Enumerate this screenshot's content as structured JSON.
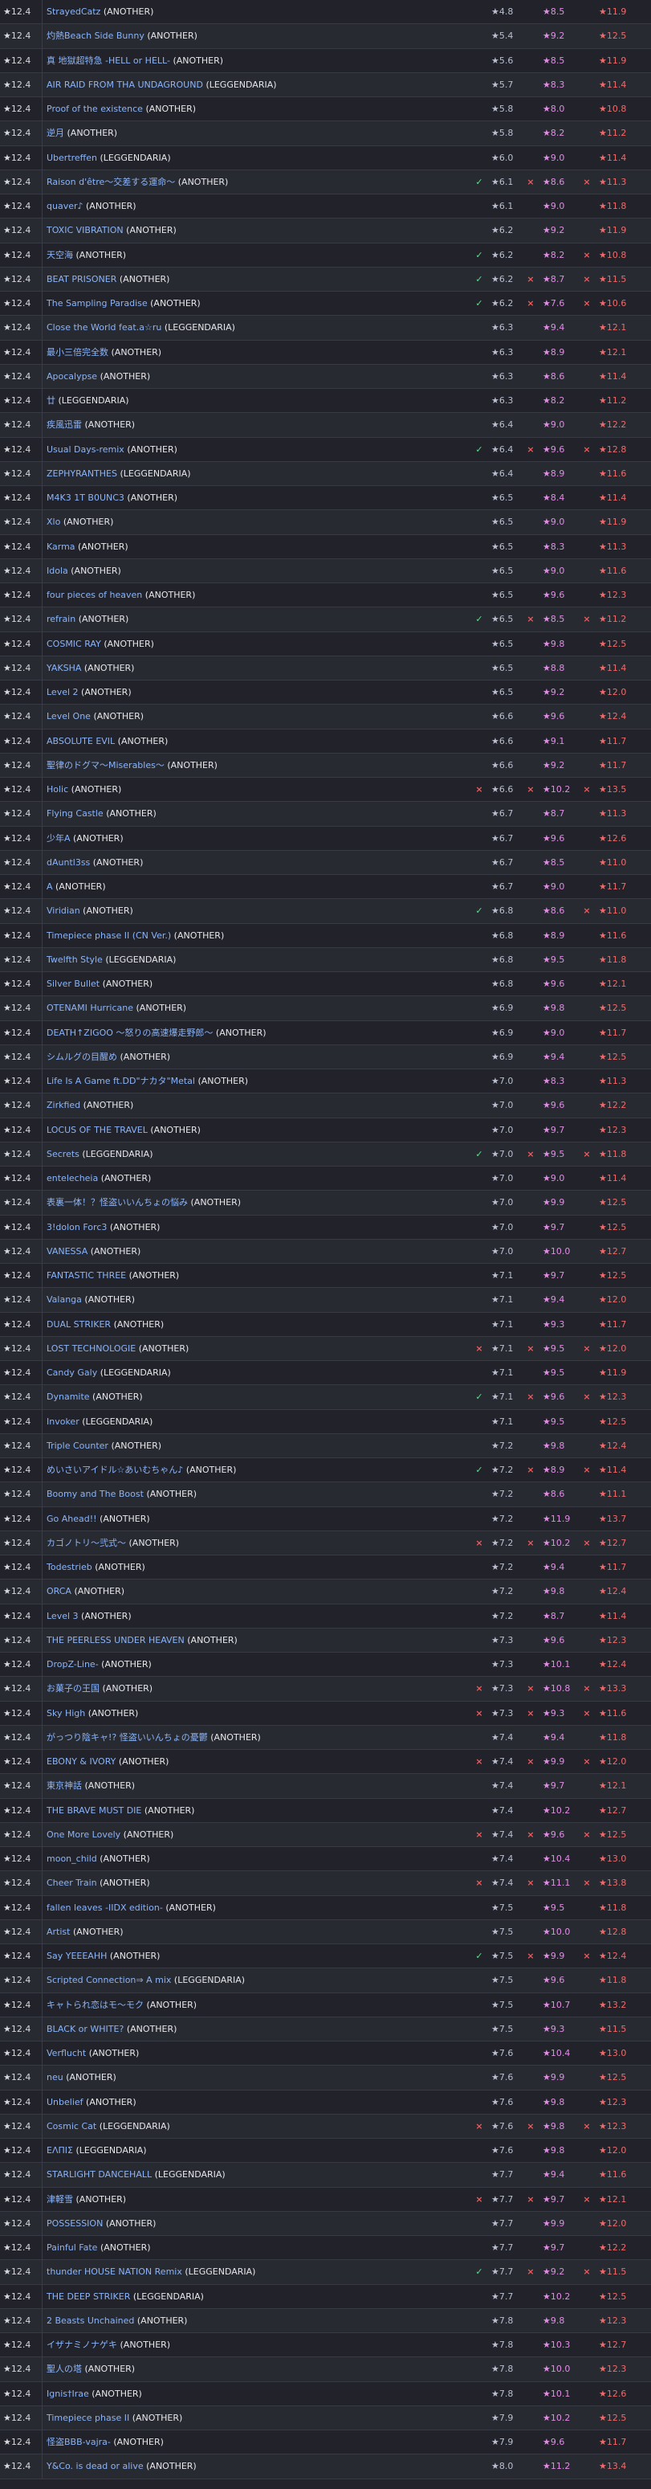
{
  "level_label": "★12.4",
  "rows": [
    {
      "title": "StrayedCatz",
      "diff": "(ANOTHER)",
      "s1": "★4.8",
      "s2": "★8.5",
      "s3": "★11.9"
    },
    {
      "title": "灼熱Beach Side Bunny",
      "diff": "(ANOTHER)",
      "s1": "★5.4",
      "s2": "★9.2",
      "s3": "★12.5"
    },
    {
      "title": "真 地獄超特急 -HELL or HELL-",
      "diff": "(ANOTHER)",
      "s1": "★5.6",
      "s2": "★8.5",
      "s3": "★11.9"
    },
    {
      "title": "AIR RAID FROM THA UNDAGROUND",
      "diff": "(LEGGENDARIA)",
      "s1": "★5.7",
      "s2": "★8.3",
      "s3": "★11.4"
    },
    {
      "title": "Proof of the existence",
      "diff": "(ANOTHER)",
      "s1": "★5.8",
      "s2": "★8.0",
      "s3": "★10.8"
    },
    {
      "title": "逆月",
      "diff": "(ANOTHER)",
      "s1": "★5.8",
      "s2": "★8.2",
      "s3": "★11.2"
    },
    {
      "title": "Ubertreffen",
      "diff": "(LEGGENDARIA)",
      "s1": "★6.0",
      "s2": "★9.0",
      "s3": "★11.4"
    },
    {
      "title": "Raison d'être～交差する運命～",
      "diff": "(ANOTHER)",
      "m1": "✓",
      "m2": "×",
      "m3": "×",
      "s1": "★6.1",
      "s2": "★8.6",
      "s3": "★11.3"
    },
    {
      "title": "quaver♪",
      "diff": "(ANOTHER)",
      "s1": "★6.1",
      "s2": "★9.0",
      "s3": "★11.8"
    },
    {
      "title": "TOXIC VIBRATION",
      "diff": "(ANOTHER)",
      "s1": "★6.2",
      "s2": "★9.2",
      "s3": "★11.9"
    },
    {
      "title": "天空海",
      "diff": "(ANOTHER)",
      "m1": "✓",
      "m3": "×",
      "s1": "★6.2",
      "s2": "★8.2",
      "s3": "★10.8"
    },
    {
      "title": "BEAT PRISONER",
      "diff": "(ANOTHER)",
      "m1": "✓",
      "m2": "×",
      "m3": "×",
      "s1": "★6.2",
      "s2": "★8.7",
      "s3": "★11.5"
    },
    {
      "title": "The Sampling Paradise",
      "diff": "(ANOTHER)",
      "m1": "✓",
      "m2": "×",
      "m3": "×",
      "s1": "★6.2",
      "s2": "★7.6",
      "s3": "★10.6"
    },
    {
      "title": "Close the World feat.a☆ru",
      "diff": "(LEGGENDARIA)",
      "s1": "★6.3",
      "s2": "★9.4",
      "s3": "★12.1"
    },
    {
      "title": "最小三倍完全数",
      "diff": "(ANOTHER)",
      "s1": "★6.3",
      "s2": "★8.9",
      "s3": "★12.1"
    },
    {
      "title": "Apocalypse",
      "diff": "(ANOTHER)",
      "s1": "★6.3",
      "s2": "★8.6",
      "s3": "★11.4"
    },
    {
      "title": "廿",
      "diff": "(LEGGENDARIA)",
      "s1": "★6.3",
      "s2": "★8.2",
      "s3": "★11.2"
    },
    {
      "title": "疾風迅雷",
      "diff": "(ANOTHER)",
      "s1": "★6.4",
      "s2": "★9.0",
      "s3": "★12.2"
    },
    {
      "title": "Usual Days-remix",
      "diff": "(ANOTHER)",
      "m1": "✓",
      "m2": "×",
      "m3": "×",
      "s1": "★6.4",
      "s2": "★9.6",
      "s3": "★12.8"
    },
    {
      "title": "ZEPHYRANTHES",
      "diff": "(LEGGENDARIA)",
      "s1": "★6.4",
      "s2": "★8.9",
      "s3": "★11.6"
    },
    {
      "title": "M4K3 1T B0UNC3",
      "diff": "(ANOTHER)",
      "s1": "★6.5",
      "s2": "★8.4",
      "s3": "★11.4"
    },
    {
      "title": "Xlo",
      "diff": "(ANOTHER)",
      "s1": "★6.5",
      "s2": "★9.0",
      "s3": "★11.9"
    },
    {
      "title": "Karma",
      "diff": "(ANOTHER)",
      "s1": "★6.5",
      "s2": "★8.3",
      "s3": "★11.3"
    },
    {
      "title": "Idola",
      "diff": "(ANOTHER)",
      "s1": "★6.5",
      "s2": "★9.0",
      "s3": "★11.6"
    },
    {
      "title": "four pieces of heaven",
      "diff": "(ANOTHER)",
      "s1": "★6.5",
      "s2": "★9.6",
      "s3": "★12.3"
    },
    {
      "title": "refrain",
      "diff": "(ANOTHER)",
      "m1": "✓",
      "m2": "×",
      "m3": "×",
      "s1": "★6.5",
      "s2": "★8.5",
      "s3": "★11.2"
    },
    {
      "title": "COSMIC RAY",
      "diff": "(ANOTHER)",
      "s1": "★6.5",
      "s2": "★9.8",
      "s3": "★12.5"
    },
    {
      "title": "YAKSHA",
      "diff": "(ANOTHER)",
      "s1": "★6.5",
      "s2": "★8.8",
      "s3": "★11.4"
    },
    {
      "title": "Level 2",
      "diff": "(ANOTHER)",
      "s1": "★6.5",
      "s2": "★9.2",
      "s3": "★12.0"
    },
    {
      "title": "Level One",
      "diff": "(ANOTHER)",
      "s1": "★6.6",
      "s2": "★9.6",
      "s3": "★12.4"
    },
    {
      "title": "ABSOLUTE EVIL",
      "diff": "(ANOTHER)",
      "s1": "★6.6",
      "s2": "★9.1",
      "s3": "★11.7"
    },
    {
      "title": "聖律のドグマ～Miserables～",
      "diff": "(ANOTHER)",
      "s1": "★6.6",
      "s2": "★9.2",
      "s3": "★11.7"
    },
    {
      "title": "Holic",
      "diff": "(ANOTHER)",
      "m1": "×",
      "m2": "×",
      "m3": "×",
      "s1": "★6.6",
      "s2": "★10.2",
      "s3": "★13.5"
    },
    {
      "title": "Flying Castle",
      "diff": "(ANOTHER)",
      "s1": "★6.7",
      "s2": "★8.7",
      "s3": "★11.3"
    },
    {
      "title": "少年A",
      "diff": "(ANOTHER)",
      "s1": "★6.7",
      "s2": "★9.6",
      "s3": "★12.6"
    },
    {
      "title": "dAuntl3ss",
      "diff": "(ANOTHER)",
      "s1": "★6.7",
      "s2": "★8.5",
      "s3": "★11.0"
    },
    {
      "title": "A",
      "diff": "(ANOTHER)",
      "s1": "★6.7",
      "s2": "★9.0",
      "s3": "★11.7"
    },
    {
      "title": "Viridian",
      "diff": "(ANOTHER)",
      "m1": "✓",
      "m3": "×",
      "s1": "★6.8",
      "s2": "★8.6",
      "s3": "★11.0"
    },
    {
      "title": "Timepiece phase II (CN Ver.)",
      "diff": "(ANOTHER)",
      "s1": "★6.8",
      "s2": "★8.9",
      "s3": "★11.6"
    },
    {
      "title": "Twelfth Style",
      "diff": "(LEGGENDARIA)",
      "s1": "★6.8",
      "s2": "★9.5",
      "s3": "★11.8"
    },
    {
      "title": "Silver Bullet",
      "diff": "(ANOTHER)",
      "s1": "★6.8",
      "s2": "★9.6",
      "s3": "★12.1"
    },
    {
      "title": "OTENAMI Hurricane",
      "diff": "(ANOTHER)",
      "s1": "★6.9",
      "s2": "★9.8",
      "s3": "★12.5"
    },
    {
      "title": "DEATH↑ZIGOO ～怒りの高速爆走野郎～",
      "diff": "(ANOTHER)",
      "s1": "★6.9",
      "s2": "★9.0",
      "s3": "★11.7"
    },
    {
      "title": "シムルグの目醒め",
      "diff": "(ANOTHER)",
      "s1": "★6.9",
      "s2": "★9.4",
      "s3": "★12.5"
    },
    {
      "title": "Life Is A Game ft.DD\"ナカタ\"Metal",
      "diff": "(ANOTHER)",
      "s1": "★7.0",
      "s2": "★8.3",
      "s3": "★11.3"
    },
    {
      "title": "Zirkfied",
      "diff": "(ANOTHER)",
      "s1": "★7.0",
      "s2": "★9.6",
      "s3": "★12.2"
    },
    {
      "title": "LOCUS OF THE TRAVEL",
      "diff": "(ANOTHER)",
      "s1": "★7.0",
      "s2": "★9.7",
      "s3": "★12.3"
    },
    {
      "title": "Secrets",
      "diff": "(LEGGENDARIA)",
      "m1": "✓",
      "m2": "×",
      "m3": "×",
      "s1": "★7.0",
      "s2": "★9.5",
      "s3": "★11.8"
    },
    {
      "title": "entelecheia",
      "diff": "(ANOTHER)",
      "s1": "★7.0",
      "s2": "★9.0",
      "s3": "★11.4"
    },
    {
      "title": "表裏一体！？怪盗いいんちょの悩み",
      "diff": "(ANOTHER)",
      "s1": "★7.0",
      "s2": "★9.9",
      "s3": "★12.5"
    },
    {
      "title": "3!dolon Forc3",
      "diff": "(ANOTHER)",
      "s1": "★7.0",
      "s2": "★9.7",
      "s3": "★12.5"
    },
    {
      "title": "VANESSA",
      "diff": "(ANOTHER)",
      "s1": "★7.0",
      "s2": "★10.0",
      "s3": "★12.7"
    },
    {
      "title": "FANTASTIC THREE",
      "diff": "(ANOTHER)",
      "s1": "★7.1",
      "s2": "★9.7",
      "s3": "★12.5"
    },
    {
      "title": "Valanga",
      "diff": "(ANOTHER)",
      "s1": "★7.1",
      "s2": "★9.4",
      "s3": "★12.0"
    },
    {
      "title": "DUAL STRIKER",
      "diff": "(ANOTHER)",
      "s1": "★7.1",
      "s2": "★9.3",
      "s3": "★11.7"
    },
    {
      "title": "LOST TECHNOLOGIE",
      "diff": "(ANOTHER)",
      "m1": "×",
      "m2": "×",
      "m3": "×",
      "s1": "★7.1",
      "s2": "★9.5",
      "s3": "★12.0"
    },
    {
      "title": "Candy Galy",
      "diff": "(LEGGENDARIA)",
      "s1": "★7.1",
      "s2": "★9.5",
      "s3": "★11.9"
    },
    {
      "title": "Dynamite",
      "diff": "(ANOTHER)",
      "m1": "✓",
      "m2": "×",
      "m3": "×",
      "s1": "★7.1",
      "s2": "★9.6",
      "s3": "★12.3"
    },
    {
      "title": "Invoker",
      "diff": "(LEGGENDARIA)",
      "s1": "★7.1",
      "s2": "★9.5",
      "s3": "★12.5"
    },
    {
      "title": "Triple Counter",
      "diff": "(ANOTHER)",
      "s1": "★7.2",
      "s2": "★9.8",
      "s3": "★12.4"
    },
    {
      "title": "めいさいアイドル☆あいむちゃん♪",
      "diff": "(ANOTHER)",
      "m1": "✓",
      "m2": "×",
      "m3": "×",
      "s1": "★7.2",
      "s2": "★8.9",
      "s3": "★11.4"
    },
    {
      "title": "Boomy and The Boost",
      "diff": "(ANOTHER)",
      "s1": "★7.2",
      "s2": "★8.6",
      "s3": "★11.1"
    },
    {
      "title": "Go Ahead!!",
      "diff": "(ANOTHER)",
      "s1": "★7.2",
      "s2": "★11.9",
      "s3": "★13.7"
    },
    {
      "title": "カゴノトリ～弐式～",
      "diff": "(ANOTHER)",
      "m1": "×",
      "m2": "×",
      "m3": "×",
      "s1": "★7.2",
      "s2": "★10.2",
      "s3": "★12.7"
    },
    {
      "title": "Todestrieb",
      "diff": "(ANOTHER)",
      "s1": "★7.2",
      "s2": "★9.4",
      "s3": "★11.7"
    },
    {
      "title": "ORCA",
      "diff": "(ANOTHER)",
      "s1": "★7.2",
      "s2": "★9.8",
      "s3": "★12.4"
    },
    {
      "title": "Level 3",
      "diff": "(ANOTHER)",
      "s1": "★7.2",
      "s2": "★8.7",
      "s3": "★11.4"
    },
    {
      "title": "THE PEERLESS UNDER HEAVEN",
      "diff": "(ANOTHER)",
      "s1": "★7.3",
      "s2": "★9.6",
      "s3": "★12.3"
    },
    {
      "title": "DropZ-Line-",
      "diff": "(ANOTHER)",
      "s1": "★7.3",
      "s2": "★10.1",
      "s3": "★12.4"
    },
    {
      "title": "お菓子の王国",
      "diff": "(ANOTHER)",
      "m1": "×",
      "m2": "×",
      "m3": "×",
      "s1": "★7.3",
      "s2": "★10.8",
      "s3": "★13.3"
    },
    {
      "title": "Sky High",
      "diff": "(ANOTHER)",
      "m1": "×",
      "m2": "×",
      "m3": "×",
      "s1": "★7.3",
      "s2": "★9.3",
      "s3": "★11.6"
    },
    {
      "title": "がっつり陰キャ!? 怪盗いいんちょの憂鬱",
      "diff": "(ANOTHER)",
      "s1": "★7.4",
      "s2": "★9.4",
      "s3": "★11.8"
    },
    {
      "title": "EBONY & IVORY",
      "diff": "(ANOTHER)",
      "m1": "×",
      "m2": "×",
      "m3": "×",
      "s1": "★7.4",
      "s2": "★9.9",
      "s3": "★12.0"
    },
    {
      "title": "東京神話",
      "diff": "(ANOTHER)",
      "s1": "★7.4",
      "s2": "★9.7",
      "s3": "★12.1"
    },
    {
      "title": "THE BRAVE MUST DIE",
      "diff": "(ANOTHER)",
      "s1": "★7.4",
      "s2": "★10.2",
      "s3": "★12.7"
    },
    {
      "title": "One More Lovely",
      "diff": "(ANOTHER)",
      "m1": "×",
      "m2": "×",
      "m3": "×",
      "s1": "★7.4",
      "s2": "★9.6",
      "s3": "★12.5"
    },
    {
      "title": "moon_child",
      "diff": "(ANOTHER)",
      "s1": "★7.4",
      "s2": "★10.4",
      "s3": "★13.0"
    },
    {
      "title": "Cheer Train",
      "diff": "(ANOTHER)",
      "m1": "×",
      "m2": "×",
      "m3": "×",
      "s1": "★7.4",
      "s2": "★11.1",
      "s3": "★13.8"
    },
    {
      "title": "fallen leaves -IIDX edition-",
      "diff": "(ANOTHER)",
      "s1": "★7.5",
      "s2": "★9.5",
      "s3": "★11.8"
    },
    {
      "title": "Artist",
      "diff": "(ANOTHER)",
      "s1": "★7.5",
      "s2": "★10.0",
      "s3": "★12.8"
    },
    {
      "title": "Say YEEEAHH",
      "diff": "(ANOTHER)",
      "m1": "✓",
      "m2": "×",
      "m3": "×",
      "s1": "★7.5",
      "s2": "★9.9",
      "s3": "★12.4"
    },
    {
      "title": "Scripted Connection⇒ A mix",
      "diff": "(LEGGENDARIA)",
      "s1": "★7.5",
      "s2": "★9.6",
      "s3": "★11.8"
    },
    {
      "title": "キャトられ恋はモ～モク",
      "diff": "(ANOTHER)",
      "s1": "★7.5",
      "s2": "★10.7",
      "s3": "★13.2"
    },
    {
      "title": "BLACK or WHITE?",
      "diff": "(ANOTHER)",
      "s1": "★7.5",
      "s2": "★9.3",
      "s3": "★11.5"
    },
    {
      "title": "Verflucht",
      "diff": "(ANOTHER)",
      "s1": "★7.6",
      "s2": "★10.4",
      "s3": "★13.0"
    },
    {
      "title": "neu",
      "diff": "(ANOTHER)",
      "s1": "★7.6",
      "s2": "★9.9",
      "s3": "★12.5"
    },
    {
      "title": "Unbelief",
      "diff": "(ANOTHER)",
      "s1": "★7.6",
      "s2": "★9.8",
      "s3": "★12.3"
    },
    {
      "title": "Cosmic Cat",
      "diff": "(LEGGENDARIA)",
      "m1": "×",
      "m2": "×",
      "m3": "×",
      "s1": "★7.6",
      "s2": "★9.8",
      "s3": "★12.3"
    },
    {
      "title": "ΕΛΠΙΣ",
      "diff": "(LEGGENDARIA)",
      "s1": "★7.6",
      "s2": "★9.8",
      "s3": "★12.0"
    },
    {
      "title": "STARLIGHT DANCEHALL",
      "diff": "(LEGGENDARIA)",
      "s1": "★7.7",
      "s2": "★9.4",
      "s3": "★11.6"
    },
    {
      "title": "津軽雪",
      "diff": "(ANOTHER)",
      "m1": "×",
      "m2": "×",
      "m3": "×",
      "s1": "★7.7",
      "s2": "★9.7",
      "s3": "★12.1"
    },
    {
      "title": "POSSESSION",
      "diff": "(ANOTHER)",
      "s1": "★7.7",
      "s2": "★9.9",
      "s3": "★12.0"
    },
    {
      "title": "Painful Fate",
      "diff": "(ANOTHER)",
      "s1": "★7.7",
      "s2": "★9.7",
      "s3": "★12.2"
    },
    {
      "title": "thunder HOUSE NATION Remix",
      "diff": "(LEGGENDARIA)",
      "m1": "✓",
      "m2": "×",
      "m3": "×",
      "s1": "★7.7",
      "s2": "★9.2",
      "s3": "★11.5"
    },
    {
      "title": "THE DEEP STRIKER",
      "diff": "(LEGGENDARIA)",
      "s1": "★7.7",
      "s2": "★10.2",
      "s3": "★12.5"
    },
    {
      "title": "2 Beasts Unchained",
      "diff": "(ANOTHER)",
      "s1": "★7.8",
      "s2": "★9.8",
      "s3": "★12.3"
    },
    {
      "title": "イザナミノナゲキ",
      "diff": "(ANOTHER)",
      "s1": "★7.8",
      "s2": "★10.3",
      "s3": "★12.7"
    },
    {
      "title": "聖人の塔",
      "diff": "(ANOTHER)",
      "s1": "★7.8",
      "s2": "★10.0",
      "s3": "★12.3"
    },
    {
      "title": "Ignis†Irae",
      "diff": "(ANOTHER)",
      "s1": "★7.8",
      "s2": "★10.1",
      "s3": "★12.6"
    },
    {
      "title": "Timepiece phase II",
      "diff": "(ANOTHER)",
      "s1": "★7.9",
      "s2": "★10.2",
      "s3": "★12.5"
    },
    {
      "title": "怪盗BBB-vajra-",
      "diff": "(ANOTHER)",
      "s1": "★7.9",
      "s2": "★9.6",
      "s3": "★11.7"
    },
    {
      "title": "Y&Co. is dead or alive",
      "diff": "(ANOTHER)",
      "s1": "★8.0",
      "s2": "★11.2",
      "s3": "★13.4"
    }
  ]
}
